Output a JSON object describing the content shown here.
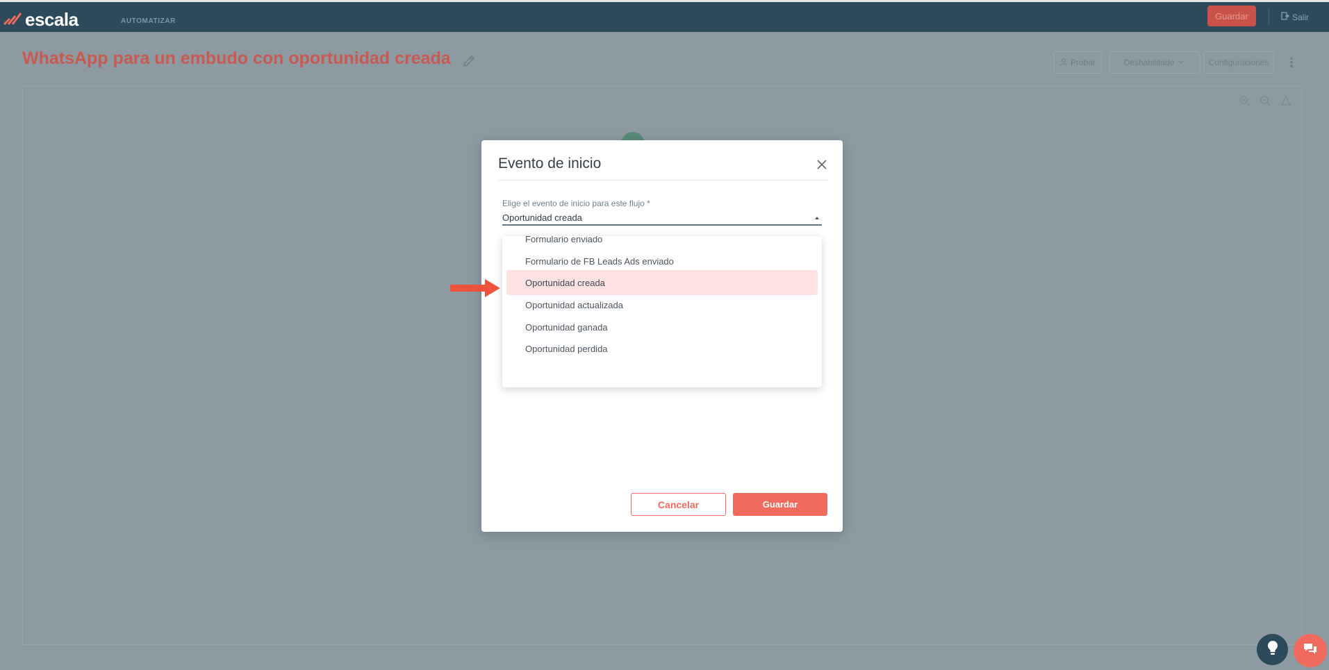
{
  "app": {
    "logo_text": "escala",
    "nav_item": "AUTOMATIZAR",
    "save_label": "Guardar",
    "exit_label": "Salir"
  },
  "page": {
    "title": "WhatsApp para un embudo con oportunidad creada",
    "toolbar": {
      "test_label": "Probar",
      "status_label": "Deshabilitado",
      "config_label": "Configuraciones",
      "more_label": "⋮"
    }
  },
  "modal": {
    "title": "Evento de inicio",
    "field_label": "Elige el evento de inicio para este flujo *",
    "field_value": "Oportunidad creada",
    "options_partial": "Formulario enviado",
    "options": [
      {
        "label": "Formulario de FB Leads Ads enviado"
      },
      {
        "label": "Oportunidad creada"
      },
      {
        "label": "Oportunidad actualizada"
      },
      {
        "label": "Oportunidad ganada"
      },
      {
        "label": "Oportunidad perdida"
      }
    ],
    "selected_option": "Oportunidad creada",
    "cancel_label": "Cancelar",
    "save_label": "Guardar"
  },
  "colors": {
    "accent": "#f06b5e",
    "header": "#2d4a5b",
    "selected_row": "#fde2e1",
    "overlay": "#8d9aa2"
  },
  "icons": {
    "title_edit": "pencil-icon",
    "close": "close-icon",
    "caret": "caret-up-icon",
    "tip": "lightbulb-icon",
    "chat": "chat-icon",
    "pointer": "arrow-right-icon"
  }
}
